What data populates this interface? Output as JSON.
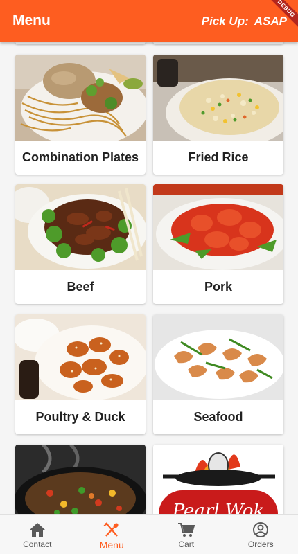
{
  "appbar": {
    "title": "Menu",
    "pickup_label": "Pick Up:",
    "pickup_value": "ASAP",
    "debug_label": "DEBUG"
  },
  "categories": [
    {
      "label": "Combination Plates",
      "image": "noodles-and-rice-plate"
    },
    {
      "label": "Fried Rice",
      "image": "fried-rice-plate"
    },
    {
      "label": "Beef",
      "image": "beef-broccoli-plate"
    },
    {
      "label": "Pork",
      "image": "sweet-sour-pork-plate"
    },
    {
      "label": "Poultry & Duck",
      "image": "sesame-chicken-plate"
    },
    {
      "label": "Seafood",
      "image": "shrimp-plate"
    },
    {
      "label": "",
      "image": "vegetable-wok"
    },
    {
      "label": "",
      "image": "pearl-wok-logo",
      "logo_text": "Pearl Wok"
    }
  ],
  "nav": {
    "contact": "Contact",
    "menu": "Menu",
    "cart": "Cart",
    "orders": "Orders",
    "active": "menu"
  },
  "colors": {
    "accent": "#fe5d20",
    "background": "#f5f5f5"
  }
}
